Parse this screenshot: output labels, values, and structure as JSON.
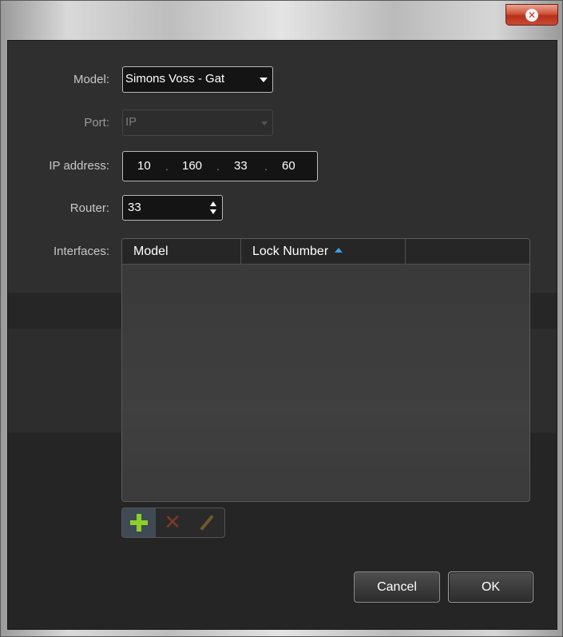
{
  "window": {
    "close_glyph": "✕"
  },
  "form": {
    "model_label": "Model:",
    "model_value": "Simons Voss - Gat",
    "port_label": "Port:",
    "port_value": "IP",
    "ip_label": "IP address:",
    "ip_octets": [
      "10",
      "160",
      "33",
      "60"
    ],
    "router_label": "Router:",
    "router_value": "33",
    "interfaces_label": "Interfaces:"
  },
  "interfaces_table": {
    "columns": [
      "Model",
      "Lock Number",
      ""
    ],
    "sort_column": "Lock Number",
    "rows": []
  },
  "toolbar": {
    "add_icon": "plus-icon",
    "delete_icon": "delete-icon",
    "edit_icon": "edit-icon"
  },
  "buttons": {
    "cancel": "Cancel",
    "ok": "OK"
  },
  "colors": {
    "accent_sort": "#3aa0e8",
    "add_green": "#8ccf2a",
    "close_red": "#c94a34"
  }
}
